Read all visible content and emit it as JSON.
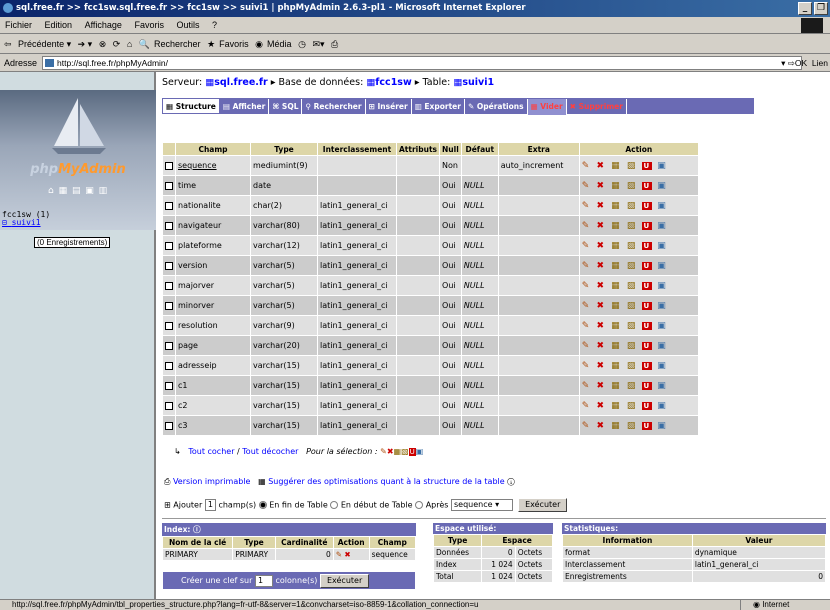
{
  "window": {
    "title": "sql.free.fr >> fcc1sw.sql.free.fr >> fcc1sw >> suivi1 | phpMyAdmin 2.6.3-pl1 - Microsoft Internet Explorer"
  },
  "menu": [
    "Fichier",
    "Edition",
    "Affichage",
    "Favoris",
    "Outils",
    "?"
  ],
  "toolbar": {
    "back": "Précédente",
    "search": "Rechercher",
    "favorites": "Favoris",
    "media": "Média"
  },
  "address": {
    "label": "Adresse",
    "url": "http://sql.free.fr/phpMyAdmin/",
    "go": "OK",
    "links": "Lien"
  },
  "left": {
    "logo_php": "php",
    "logo_my": "MyAdmin",
    "icons": "⌂ ▦ ▤ ▣ ▥",
    "db": "fcc1sw (1)",
    "table": "suivi1",
    "tooltip": "(0 Enregistrements)"
  },
  "breadcrumb": {
    "server_label": "Serveur:",
    "server": "sql.free.fr",
    "db_label": "Base de données:",
    "db": "fcc1sw",
    "table_label": "Table:",
    "table": "suivi1"
  },
  "tabs": [
    "Structure",
    "Afficher",
    "SQL",
    "Rechercher",
    "Insérer",
    "Exporter",
    "Opérations",
    "Vider",
    "Supprimer"
  ],
  "table_headers": [
    "",
    "Champ",
    "Type",
    "Interclassement",
    "Attributs",
    "Null",
    "Défaut",
    "Extra",
    "Action"
  ],
  "rows": [
    {
      "champ": "sequence",
      "type": "mediumint(9)",
      "coll": "",
      "attr": "",
      "null": "Non",
      "def": "",
      "extra": "auto_increment"
    },
    {
      "champ": "time",
      "type": "date",
      "coll": "",
      "attr": "",
      "null": "Oui",
      "def": "NULL",
      "extra": ""
    },
    {
      "champ": "nationalite",
      "type": "char(2)",
      "coll": "latin1_general_ci",
      "attr": "",
      "null": "Oui",
      "def": "NULL",
      "extra": ""
    },
    {
      "champ": "navigateur",
      "type": "varchar(80)",
      "coll": "latin1_general_ci",
      "attr": "",
      "null": "Oui",
      "def": "NULL",
      "extra": ""
    },
    {
      "champ": "plateforme",
      "type": "varchar(12)",
      "coll": "latin1_general_ci",
      "attr": "",
      "null": "Oui",
      "def": "NULL",
      "extra": ""
    },
    {
      "champ": "version",
      "type": "varchar(5)",
      "coll": "latin1_general_ci",
      "attr": "",
      "null": "Oui",
      "def": "NULL",
      "extra": ""
    },
    {
      "champ": "majorver",
      "type": "varchar(5)",
      "coll": "latin1_general_ci",
      "attr": "",
      "null": "Oui",
      "def": "NULL",
      "extra": ""
    },
    {
      "champ": "minorver",
      "type": "varchar(5)",
      "coll": "latin1_general_ci",
      "attr": "",
      "null": "Oui",
      "def": "NULL",
      "extra": ""
    },
    {
      "champ": "resolution",
      "type": "varchar(9)",
      "coll": "latin1_general_ci",
      "attr": "",
      "null": "Oui",
      "def": "NULL",
      "extra": ""
    },
    {
      "champ": "page",
      "type": "varchar(20)",
      "coll": "latin1_general_ci",
      "attr": "",
      "null": "Oui",
      "def": "NULL",
      "extra": ""
    },
    {
      "champ": "adresseip",
      "type": "varchar(15)",
      "coll": "latin1_general_ci",
      "attr": "",
      "null": "Oui",
      "def": "NULL",
      "extra": ""
    },
    {
      "champ": "c1",
      "type": "varchar(15)",
      "coll": "latin1_general_ci",
      "attr": "",
      "null": "Oui",
      "def": "NULL",
      "extra": ""
    },
    {
      "champ": "c2",
      "type": "varchar(15)",
      "coll": "latin1_general_ci",
      "attr": "",
      "null": "Oui",
      "def": "NULL",
      "extra": ""
    },
    {
      "champ": "c3",
      "type": "varchar(15)",
      "coll": "latin1_general_ci",
      "attr": "",
      "null": "Oui",
      "def": "NULL",
      "extra": ""
    }
  ],
  "checkall": {
    "all": "Tout cocher",
    "none": "Tout décocher",
    "selection": "Pour la sélection :"
  },
  "extras": {
    "print": "Version imprimable",
    "suggest": "Suggérer des optimisations quant à la structure de la table"
  },
  "addfield": {
    "prefix": "Ajouter",
    "count": "1",
    "label": "champ(s)",
    "end": "En fin de Table",
    "start": "En début de Table",
    "after": "Après",
    "after_field": "sequence",
    "go": "Exécuter"
  },
  "index": {
    "title": "Index:",
    "headers": [
      "Nom de la clé",
      "Type",
      "Cardinalité",
      "Action",
      "Champ"
    ],
    "rows": [
      {
        "name": "PRIMARY",
        "type": "PRIMARY",
        "card": "0",
        "field": "sequence"
      }
    ],
    "create_prefix": "Créer une clef sur",
    "create_count": "1",
    "create_suffix": "colonne(s)",
    "create_go": "Exécuter"
  },
  "space": {
    "title": "Espace utilisé:",
    "headers": [
      "Type",
      "Espace"
    ],
    "rows": [
      [
        "Données",
        "0",
        "Octets"
      ],
      [
        "Index",
        "1 024",
        "Octets"
      ],
      [
        "Total",
        "1 024",
        "Octets"
      ]
    ]
  },
  "stats": {
    "title": "Statistiques:",
    "headers": [
      "Information",
      "Valeur"
    ],
    "rows": [
      [
        "format",
        "dynamique"
      ],
      [
        "Interclassement",
        "latin1_general_ci"
      ],
      [
        "Enregistrements",
        "0"
      ]
    ]
  },
  "status": {
    "url": "http://sql.free.fr/phpMyAdmin/tbl_properties_structure.php?lang=fr-utf-8&server=1&convcharset=iso-8859-1&collation_connection=u",
    "zone": "Internet"
  }
}
